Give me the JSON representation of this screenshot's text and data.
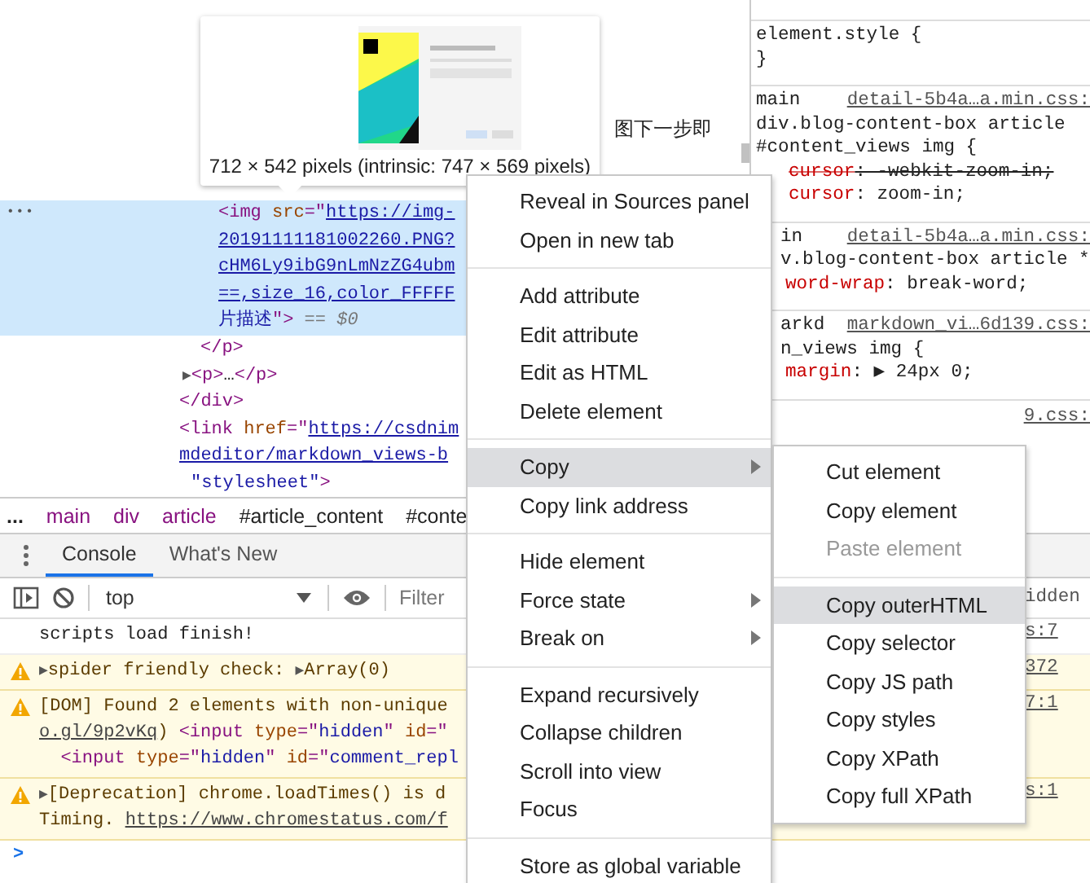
{
  "elements_tree": {
    "lines": [
      {
        "selected": true,
        "segs": [
          {
            "kind": "tag",
            "text": "<img "
          },
          {
            "kind": "attr",
            "text": "src"
          },
          {
            "kind": "tag",
            "text": "=\""
          },
          {
            "kind": "link",
            "text": "https://img-"
          }
        ]
      },
      {
        "selected": true,
        "segs": [
          {
            "kind": "link",
            "text": "20191111181002260.PNG?"
          }
        ]
      },
      {
        "selected": true,
        "segs": [
          {
            "kind": "link",
            "text": "cHM6Ly9ibG9nLmNzZG4ubm"
          }
        ]
      },
      {
        "selected": true,
        "segs": [
          {
            "kind": "link",
            "text": "==,size_16,color_FFFFF"
          }
        ]
      },
      {
        "selected": true,
        "segs": [
          {
            "kind": "value",
            "text": "片描述"
          },
          {
            "kind": "tag",
            "text": "\">"
          },
          {
            "kind": "dim",
            "text": " == $0"
          }
        ]
      },
      {
        "selected": false,
        "segs": [
          {
            "kind": "tag",
            "text": "</p>"
          }
        ]
      },
      {
        "selected": false,
        "segs": [
          {
            "kind": "arrow",
            "text": "▶"
          },
          {
            "kind": "tag",
            "text": "<p>"
          },
          {
            "kind": "text",
            "text": "…"
          },
          {
            "kind": "tag",
            "text": "</p>"
          }
        ]
      },
      {
        "selected": false,
        "segs": [
          {
            "kind": "tag",
            "text": "</div>"
          }
        ]
      },
      {
        "selected": false,
        "segs": [
          {
            "kind": "tag",
            "text": "<link "
          },
          {
            "kind": "attr",
            "text": "href"
          },
          {
            "kind": "tag",
            "text": "=\""
          },
          {
            "kind": "link",
            "text": "https://csdnim"
          }
        ]
      },
      {
        "selected": false,
        "segs": [
          {
            "kind": "link",
            "text": "mdeditor/markdown_views-b"
          }
        ]
      },
      {
        "selected": false,
        "segs": [
          {
            "kind": "value",
            "text": "\"stylesheet\""
          },
          {
            "kind": "tag",
            "text": ">"
          }
        ]
      }
    ],
    "selected_marker": "•••"
  },
  "tooltip": {
    "caption": "712 × 542 pixels (intrinsic: 747 × 569 pixels)"
  },
  "page_text": "图下一步即",
  "breadcrumb": [
    {
      "label": "...",
      "kind": "more"
    },
    {
      "label": "main",
      "kind": "tag"
    },
    {
      "label": "div",
      "kind": "tag"
    },
    {
      "label": "article",
      "kind": "tag"
    },
    {
      "label": "#article_content",
      "kind": "id"
    },
    {
      "label": "#conte",
      "kind": "id"
    }
  ],
  "styles": {
    "sections": [
      {
        "lines": [
          "element.style {",
          "}"
        ],
        "cut": false
      },
      {
        "selector": "main",
        "source": "detail-5b4a…a.min.css:",
        "lines": [
          "div.blog-content-box article",
          "#content_views img {"
        ],
        "declarations": [
          {
            "text": "cursor: -webkit-zoom-in;",
            "overridden": true
          },
          {
            "text": "cursor: zoom-in;",
            "overridden": false
          }
        ],
        "cut": false
      },
      {
        "selector": "in",
        "source": "detail-5b4a…a.min.css:",
        "lines": [
          "v.blog-content-box article *"
        ],
        "declarations": [
          {
            "text": "word-wrap: break-word;",
            "overridden": false
          }
        ],
        "cut": true
      },
      {
        "selector": "arkd",
        "source": "markdown_vi…6d139.css:",
        "lines": [
          "n_views img {"
        ],
        "declarations": [
          {
            "text": "margin: ▶ 24px 0;",
            "overridden": false
          }
        ],
        "cut": true
      }
    ],
    "trailing_source": "9.css:"
  },
  "drawer": {
    "tabs": [
      {
        "label": "Console",
        "selected": true
      },
      {
        "label": "What's New",
        "selected": false
      }
    ],
    "context": "top",
    "filter_placeholder": "Filter",
    "hidden_note": "idden",
    "messages": [
      {
        "kind": "log",
        "lines": [
          [
            {
              "kind": "text",
              "text": "scripts load finish!"
            }
          ]
        ],
        "source": "s:7"
      },
      {
        "kind": "warning",
        "lines": [
          [
            {
              "kind": "arrow",
              "text": "▶"
            },
            {
              "kind": "text",
              "text": "spider friendly check: "
            },
            {
              "kind": "arrow",
              "text": "▶"
            },
            {
              "kind": "text",
              "text": "Array(0)"
            }
          ]
        ],
        "source": "372"
      },
      {
        "kind": "warning",
        "lines": [
          [
            {
              "kind": "text",
              "text": "[DOM] Found 2 elements with non-unique"
            }
          ],
          [
            {
              "kind": "link",
              "text": "o.gl/9p2vKq"
            },
            {
              "kind": "text",
              "text": ")   "
            },
            {
              "kind": "tag",
              "text": "<input "
            },
            {
              "kind": "attr",
              "text": "type"
            },
            {
              "kind": "tag",
              "text": "=\""
            },
            {
              "kind": "value",
              "text": "hidden"
            },
            {
              "kind": "tag",
              "text": "\" "
            },
            {
              "kind": "attr",
              "text": "id"
            },
            {
              "kind": "tag",
              "text": "=\""
            }
          ],
          [
            {
              "kind": "tag",
              "text": "<input "
            },
            {
              "kind": "attr",
              "text": "type"
            },
            {
              "kind": "tag",
              "text": "=\""
            },
            {
              "kind": "value",
              "text": "hidden"
            },
            {
              "kind": "tag",
              "text": "\" "
            },
            {
              "kind": "attr",
              "text": "id"
            },
            {
              "kind": "tag",
              "text": "=\""
            },
            {
              "kind": "value",
              "text": "comment_repl"
            }
          ]
        ],
        "source": "7:1"
      },
      {
        "kind": "warning",
        "lines": [
          [
            {
              "kind": "arrow",
              "text": "▶"
            },
            {
              "kind": "text",
              "text": "[Deprecation] chrome.loadTimes() is d"
            }
          ],
          [
            {
              "kind": "text",
              "text": "Timing. "
            },
            {
              "kind": "link",
              "text": "https://www.chromestatus.com/f"
            }
          ]
        ],
        "source": "s:1"
      }
    ],
    "prompt": ">"
  },
  "context_menu": {
    "groups": [
      [
        {
          "label": "Reveal in Sources panel",
          "selected": false,
          "has_submenu": false
        },
        {
          "label": "Open in new tab",
          "selected": false,
          "has_submenu": false
        }
      ],
      [
        {
          "label": "Add attribute",
          "selected": false,
          "has_submenu": false
        },
        {
          "label": "Edit attribute",
          "selected": false,
          "has_submenu": false
        },
        {
          "label": "Edit as HTML",
          "selected": false,
          "has_submenu": false
        },
        {
          "label": "Delete element",
          "selected": false,
          "has_submenu": false
        }
      ],
      [
        {
          "label": "Copy",
          "selected": true,
          "has_submenu": true
        },
        {
          "label": "Copy link address",
          "selected": false,
          "has_submenu": false
        }
      ],
      [
        {
          "label": "Hide element",
          "selected": false,
          "has_submenu": false
        },
        {
          "label": "Force state",
          "selected": false,
          "has_submenu": true
        },
        {
          "label": "Break on",
          "selected": false,
          "has_submenu": true
        }
      ],
      [
        {
          "label": "Expand recursively",
          "selected": false,
          "has_submenu": false
        },
        {
          "label": "Collapse children",
          "selected": false,
          "has_submenu": false
        },
        {
          "label": "Scroll into view",
          "selected": false,
          "has_submenu": false
        },
        {
          "label": "Focus",
          "selected": false,
          "has_submenu": false
        }
      ],
      [
        {
          "label": "Store as global variable",
          "selected": false,
          "has_submenu": false
        }
      ]
    ]
  },
  "copy_submenu": {
    "groups": [
      [
        {
          "label": "Cut element",
          "selected": false,
          "disabled": false
        },
        {
          "label": "Copy element",
          "selected": false,
          "disabled": false
        },
        {
          "label": "Paste element",
          "selected": false,
          "disabled": true
        }
      ],
      [
        {
          "label": "Copy outerHTML",
          "selected": true,
          "disabled": false
        },
        {
          "label": "Copy selector",
          "selected": false,
          "disabled": false
        },
        {
          "label": "Copy JS path",
          "selected": false,
          "disabled": false
        },
        {
          "label": "Copy styles",
          "selected": false,
          "disabled": false
        },
        {
          "label": "Copy XPath",
          "selected": false,
          "disabled": false
        },
        {
          "label": "Copy full XPath",
          "selected": false,
          "disabled": false
        }
      ]
    ]
  }
}
